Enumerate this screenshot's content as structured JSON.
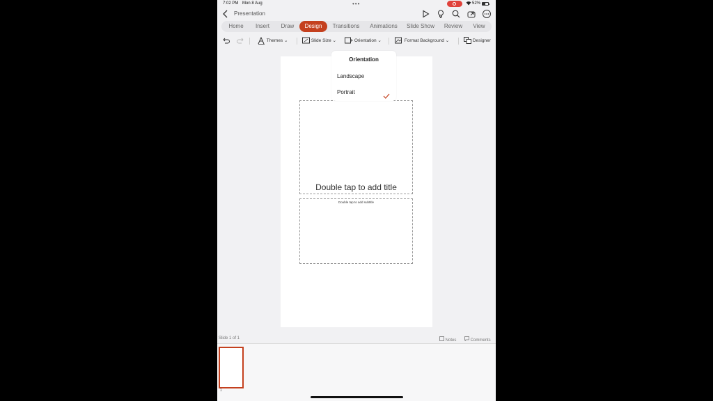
{
  "status": {
    "time": "7:02 PM",
    "date": "Mon 8 Aug",
    "battery": "52%"
  },
  "header": {
    "title": "Presentation"
  },
  "tabs": [
    {
      "label": "Home"
    },
    {
      "label": "Insert"
    },
    {
      "label": "Draw"
    },
    {
      "label": "Design"
    },
    {
      "label": "Transitions"
    },
    {
      "label": "Animations"
    },
    {
      "label": "Slide Show"
    },
    {
      "label": "Review"
    },
    {
      "label": "View"
    }
  ],
  "active_tab": "Design",
  "toolbar": {
    "themes": "Themes",
    "slide_size": "Slide Size",
    "orientation": "Orientation",
    "format_background": "Format Background",
    "designer": "Designer"
  },
  "popup": {
    "title": "Orientation",
    "options": [
      "Landscape",
      "Portrait"
    ],
    "selected": "Portrait"
  },
  "slide": {
    "title_placeholder": "Double tap to add title",
    "subtitle_placeholder": "Double tap to add subtitle"
  },
  "footer": {
    "slide_count": "Slide 1 of 1",
    "notes": "Notes",
    "comments": "Comments",
    "thumbnail_number": "1"
  },
  "colors": {
    "accent": "#c4401e",
    "record": "#e0413a"
  }
}
